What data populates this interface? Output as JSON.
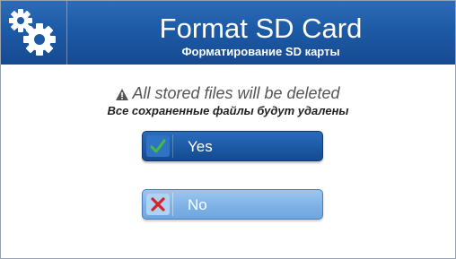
{
  "header": {
    "title": "Format SD Card",
    "subtitle": "Форматирование SD карты",
    "icon": "gears-icon"
  },
  "warning": {
    "text": "All stored files will be deleted",
    "text_ru": "Все сохраненные файлы будут удалены",
    "icon": "warning-icon"
  },
  "buttons": {
    "yes_label": "Yes",
    "yes_icon": "check-icon",
    "no_label": "No",
    "no_icon": "cross-icon"
  },
  "colors": {
    "header_blue": "#1d5aa6",
    "yes_button_blue": "#1c5aa5",
    "no_button_light_blue": "#7fb3e6",
    "check_green": "#3fbf3f",
    "cross_red": "#d42424"
  }
}
